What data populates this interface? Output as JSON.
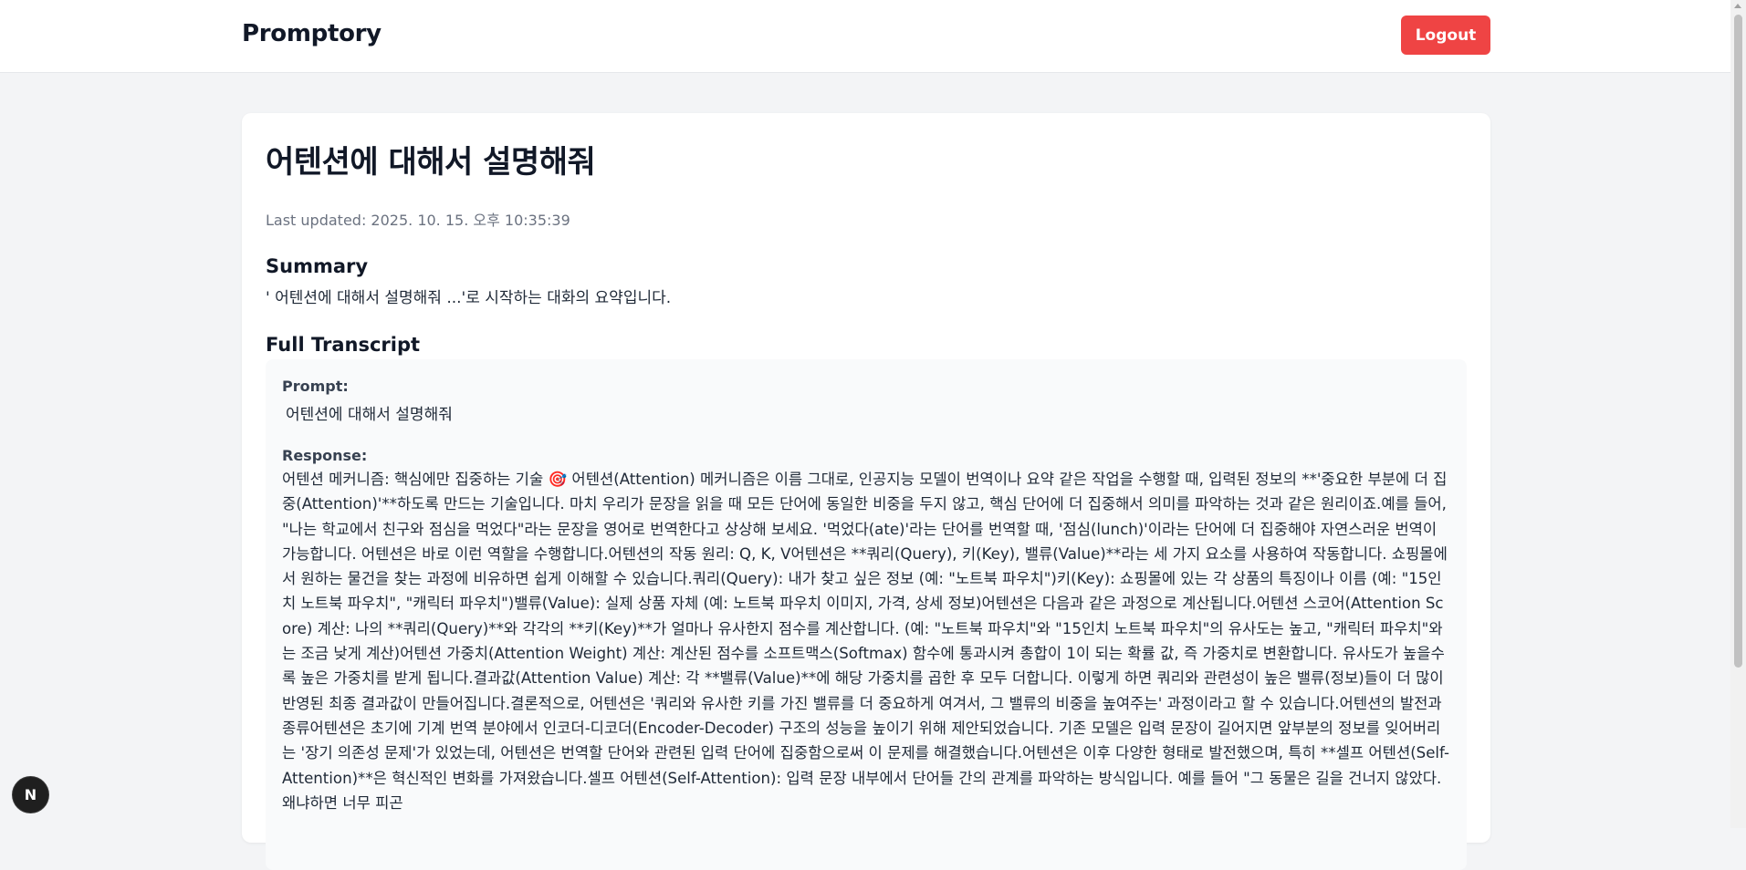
{
  "header": {
    "brand": "Promptory",
    "logout_label": "Logout",
    "logout_color": "#ef4444"
  },
  "conversation": {
    "title": "어텐션에 대해서 설명해줘",
    "last_updated": "Last updated: 2025. 10. 15. 오후 10:35:39",
    "summary_heading": "Summary",
    "summary_text": "' 어텐션에 대해서 설명해줘 ...'로 시작하는 대화의 요약입니다.",
    "transcript_heading": "Full Transcript",
    "prompt_label": "Prompt:",
    "prompt_text": "어텐션에 대해서 설명해줘",
    "response_label": "Response:",
    "response_text": "어텐션 메커니즘: 핵심에만 집중하는 기술 🎯 어텐션(Attention) 메커니즘은 이름 그대로, 인공지능 모델이 번역이나 요약 같은 작업을 수행할 때, 입력된 정보의 **'중요한 부분에 더 집중(Attention)'**하도록 만드는 기술입니다. 마치 우리가 문장을 읽을 때 모든 단어에 동일한 비중을 두지 않고, 핵심 단어에 더 집중해서 의미를 파악하는 것과 같은 원리이죠.예를 들어, \"나는 학교에서 친구와 점심을 먹었다\"라는 문장을 영어로 번역한다고 상상해 보세요. '먹었다(ate)'라는 단어를 번역할 때, '점심(lunch)'이라는 단어에 더 집중해야 자연스러운 번역이 가능합니다. 어텐션은 바로 이런 역할을 수행합니다.어텐션의 작동 원리: Q, K, V어텐션은 **쿼리(Query), 키(Key), 밸류(Value)**라는 세 가지 요소를 사용하여 작동합니다. 쇼핑몰에서 원하는 물건을 찾는 과정에 비유하면 쉽게 이해할 수 있습니다.쿼리(Query): 내가 찾고 싶은 정보 (예: \"노트북 파우치\")키(Key): 쇼핑몰에 있는 각 상품의 특징이나 이름 (예: \"15인치 노트북 파우치\", \"캐릭터 파우치\")밸류(Value): 실제 상품 자체 (예: 노트북 파우치 이미지, 가격, 상세 정보)어텐션은 다음과 같은 과정으로 계산됩니다.어텐션 스코어(Attention Score) 계산: 나의 **쿼리(Query)**와 각각의 **키(Key)**가 얼마나 유사한지 점수를 계산합니다. (예: \"노트북 파우치\"와 \"15인치 노트북 파우치\"의 유사도는 높고, \"캐릭터 파우치\"와는 조금 낮게 계산)어텐션 가중치(Attention Weight) 계산: 계산된 점수를 소프트맥스(Softmax) 함수에 통과시켜 총합이 1이 되는 확률 값, 즉 가중치로 변환합니다. 유사도가 높을수록 높은 가중치를 받게 됩니다.결과값(Attention Value) 계산: 각 **밸류(Value)**에 해당 가중치를 곱한 후 모두 더합니다. 이렇게 하면 쿼리와 관련성이 높은 밸류(정보)들이 더 많이 반영된 최종 결과값이 만들어집니다.결론적으로, 어텐션은 '쿼리와 유사한 키를 가진 밸류를 더 중요하게 여겨서, 그 밸류의 비중을 높여주는' 과정이라고 할 수 있습니다.어텐션의 발전과 종류어텐션은 초기에 기계 번역 분야에서 인코더-디코더(Encoder-Decoder) 구조의 성능을 높이기 위해 제안되었습니다. 기존 모델은 입력 문장이 길어지면 앞부분의 정보를 잊어버리는 '장기 의존성 문제'가 있었는데, 어텐션은 번역할 단어와 관련된 입력 단어에 집중함으로써 이 문제를 해결했습니다.어텐션은 이후 다양한 형태로 발전했으며, 특히 **셀프 어텐션(Self-Attention)**은 혁신적인 변화를 가져왔습니다.셀프 어텐션(Self-Attention): 입력 문장 내부에서 단어들 간의 관계를 파악하는 방식입니다. 예를 들어 \"그 동물은 길을 건너지 않았다. 왜냐하면 너무 피곤"
  },
  "dev_badge": {
    "letter": "N"
  }
}
